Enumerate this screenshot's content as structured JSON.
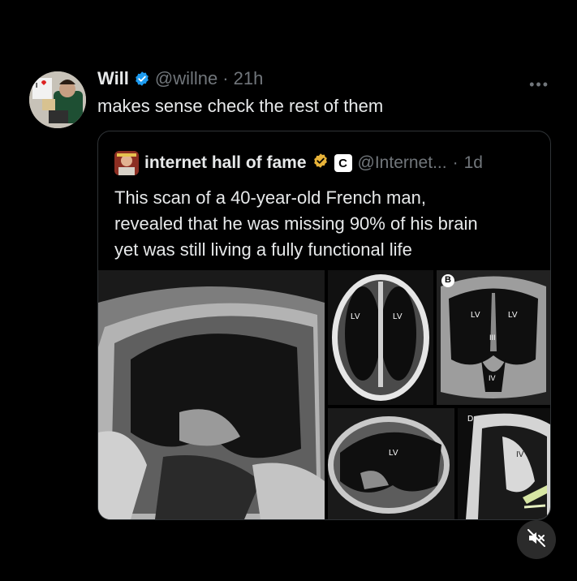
{
  "post": {
    "author_name": "Will",
    "handle": "@willne",
    "separator": "·",
    "time": "21h",
    "text": "makes sense check the rest of them",
    "more_icon": "more-icon",
    "verified_color": "#1d9bf0"
  },
  "quote": {
    "author_name": "internet hall of fame",
    "badge_letter": "C",
    "handle": "@Internet...",
    "separator": "·",
    "time": "1d",
    "lines": [
      "This scan of a 40-year-old French man,",
      "revealed that he was missing 90% of his brain",
      "yet was still living a fully functional life"
    ],
    "verified_color": "#e8b339",
    "media": {
      "labels": [
        "LV",
        "LV",
        "LV",
        "LV",
        "III",
        "IV",
        "LV",
        "IV",
        "B",
        "D"
      ]
    }
  },
  "controls": {
    "mute_icon": "volume-mute-icon"
  }
}
